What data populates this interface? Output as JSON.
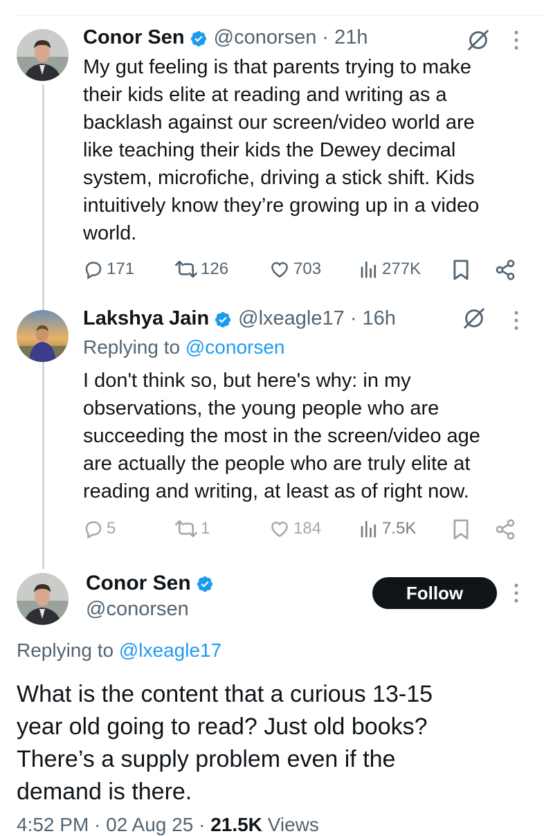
{
  "tweets": [
    {
      "name": "Conor Sen",
      "handle": "@conorsen",
      "time": "21h",
      "text": "My gut feeling is that parents trying to make\ntheir kids elite at reading and writing as a\nbacklash against our screen/video world are\nlike teaching their kids the Dewey decimal\nsystem, microfiche, driving a stick shift. Kids\nintuitively know they’re growing up in a video\nworld.",
      "replies": "171",
      "reposts": "126",
      "likes": "703",
      "views": "277K"
    },
    {
      "name": "Lakshya Jain",
      "handle": "@lxeagle17",
      "time": "16h",
      "replying_prefix": "Replying to",
      "replying_to": "@conorsen",
      "text": "I don't think so, but here's why: in my\nobservations, the young people who are\nsucceeding the most in the screen/video age\nare actually the people who are truly elite at\nreading and writing, at least as of right now.",
      "replies": "5",
      "reposts": "1",
      "likes": "184",
      "views": "7.5K"
    }
  ],
  "main": {
    "name": "Conor Sen",
    "handle": "@conorsen",
    "follow_label": "Follow",
    "replying_prefix": "Replying to",
    "replying_to": "@lxeagle17",
    "text": "What is the content that a curious 13-15\nyear old going to read? Just old books?\nThere’s a supply problem even if the\ndemand is there.",
    "time": "4:52 PM",
    "date": "02 Aug 25",
    "views_count": "21.5K",
    "views_label": "Views"
  },
  "colors": {
    "accent": "#1d9bf0",
    "text": "#0f1419",
    "muted": "#536471",
    "follow_bg": "#0f1419"
  },
  "icons": [
    "verified-badge-icon",
    "grok-icon",
    "more-icon",
    "reply-icon",
    "repost-icon",
    "like-icon",
    "views-icon",
    "bookmark-icon",
    "share-icon"
  ]
}
